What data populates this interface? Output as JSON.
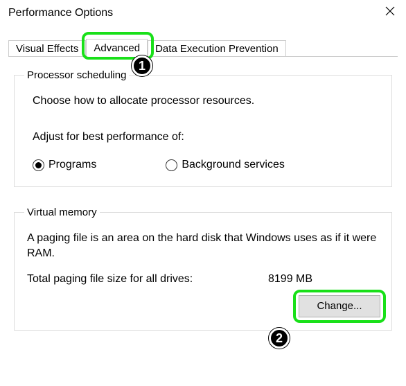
{
  "window": {
    "title": "Performance Options"
  },
  "tabs": {
    "visual_effects": "Visual Effects",
    "advanced": "Advanced",
    "dep": "Data Execution Prevention"
  },
  "processor": {
    "legend": "Processor scheduling",
    "description": "Choose how to allocate processor resources.",
    "adjust_label": "Adjust for best performance of:",
    "option_programs": "Programs",
    "option_background": "Background services",
    "selected": "programs"
  },
  "virtual_memory": {
    "legend": "Virtual memory",
    "description": "A paging file is an area on the hard disk that Windows uses as if it were RAM.",
    "total_label": "Total paging file size for all drives:",
    "total_value": "8199 MB",
    "change_button": "Change..."
  },
  "callouts": {
    "one": "1",
    "two": "2"
  }
}
